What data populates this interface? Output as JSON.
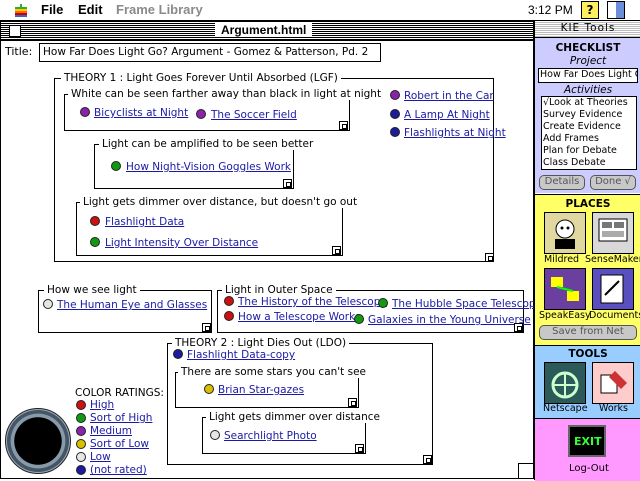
{
  "menubar": {
    "file": "File",
    "edit": "Edit",
    "frame_library": "Frame Library",
    "clock": "3:12 PM"
  },
  "window": {
    "title": "Argument.html"
  },
  "title_field": {
    "label": "Title:",
    "value": "How Far Does Light Go? Argument - Gomez & Patterson, Pd. 2"
  },
  "theory1": {
    "label": "THEORY 1 : Light Goes Forever Until Absorbed (LGF)",
    "frame_white": {
      "label": "White can be seen farther away than black in light at night",
      "ev1": "Bicyclists at Night",
      "ev2": "The Soccer Field"
    },
    "side": {
      "ev1": "Robert in the Car",
      "ev2": "A Lamp At Night",
      "ev3": "Flashlights at Night"
    },
    "frame_amplified": {
      "label": "Light can be amplified to be seen better",
      "ev1": "How Night-Vision Goggles Work"
    },
    "frame_dimmer": {
      "label": "Light gets dimmer over distance, but doesn't go out",
      "ev1": "Flashlight Data",
      "ev2": "Light Intensity Over Distance"
    }
  },
  "how_we_see": {
    "label": "How we see light",
    "ev1": "The Human Eye and Glasses"
  },
  "outer_space": {
    "label": "Light in Outer Space",
    "ev1": "The History of the Telescope",
    "ev2": "How a Telescope Works",
    "ev3": "The Hubble Space Telescope",
    "ev4": "Galaxies in the Young Universe"
  },
  "theory2": {
    "label": "THEORY 2 : Light Dies Out (LDO)",
    "ev1": "Flashlight Data-copy",
    "frame_stars": {
      "label": "There are some stars you can't see",
      "ev1": "Brian Star-gazes"
    },
    "frame_dimmer": {
      "label": "Light gets dimmer over distance",
      "ev1": "Searchlight Photo"
    }
  },
  "ratings": {
    "title": "COLOR RATINGS:",
    "high": "High",
    "sort_high": "Sort of High",
    "medium": "Medium",
    "sort_low": "Sort of Low",
    "low": "Low",
    "not_rated": "(not rated)"
  },
  "colors": {
    "red": "#cc1111",
    "green": "#119911",
    "purple": "#8a22aa",
    "yellow": "#d8c000",
    "white": "#e6e6e6",
    "blue": "#1c1c9c",
    "yellow_panel": "#ffff66",
    "blue_panel": "#99ccff",
    "pink_panel": "#ff99ff",
    "lavender_panel": "#ccccff"
  },
  "panel": {
    "title": "KIE Tools",
    "checklist": "CHECKLIST",
    "project_label": "Project",
    "project_value": "How Far Does Light Go",
    "activities_label": "Activities",
    "activities": [
      "√Look at Theories",
      "Survey Evidence",
      "Create Evidence",
      "Add Frames",
      "Plan for Debate",
      "Class Debate"
    ],
    "details": "Details",
    "done": "Done √",
    "places": "PLACES",
    "mildred": "Mildred",
    "sensemaker": "SenseMaker",
    "speakeasy": "SpeakEasy",
    "documents": "Documents",
    "save_from_net": "Save from Net",
    "tools": "TOOLS",
    "netscape": "Netscape",
    "works": "Works",
    "exit_label": "EXIT",
    "logout": "Log-Out"
  }
}
